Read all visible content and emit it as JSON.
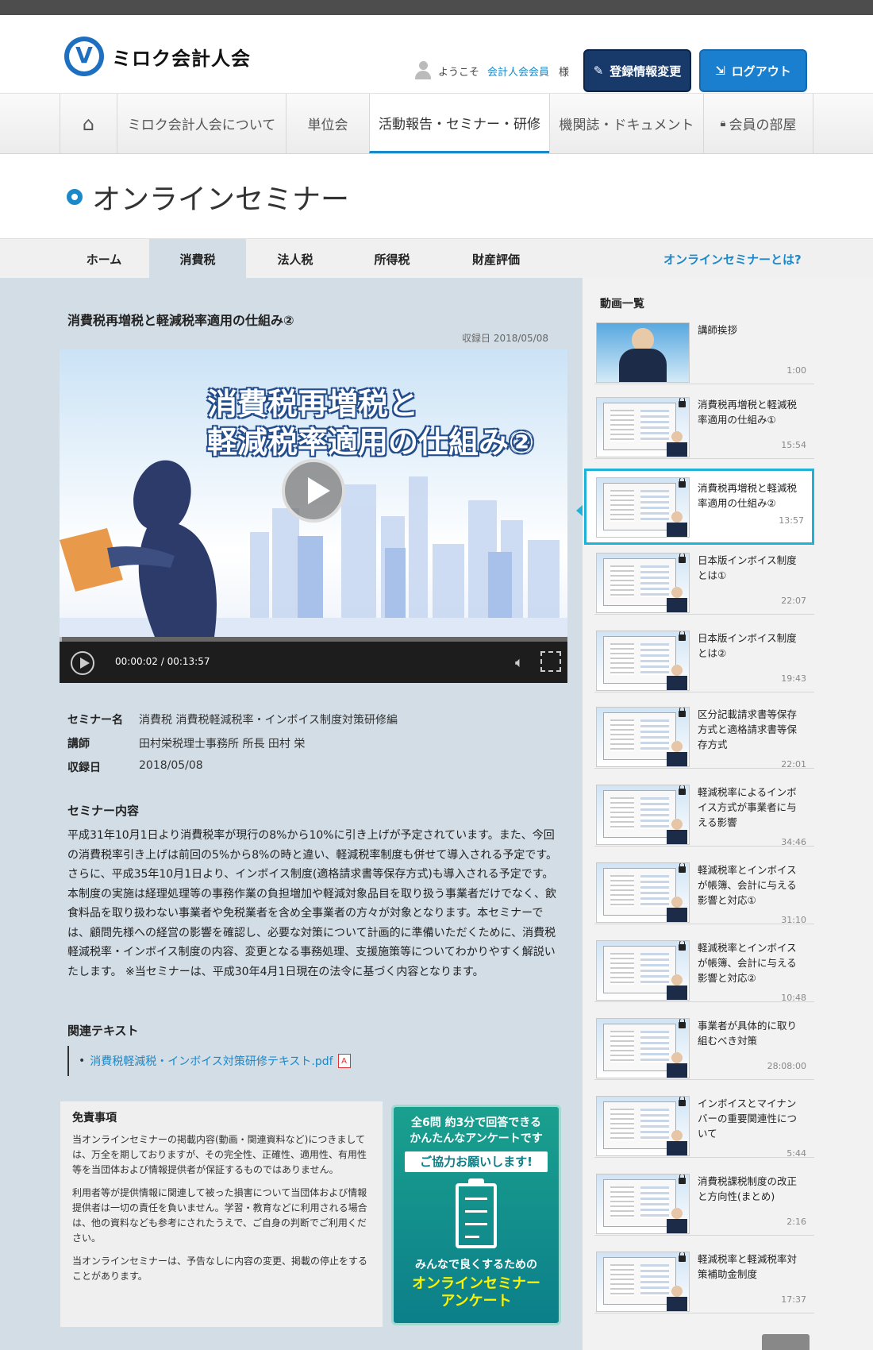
{
  "header": {
    "logo_text": "ミロク会計人会",
    "welcome": "ようこそ",
    "user_name": "会計人会会員",
    "honorific": "様",
    "register_label": "登録情報変更",
    "logout_label": "ログアウト"
  },
  "nav": {
    "items": [
      "ミロク会計人会について",
      "単位会",
      "活動報告・セミナー・研修",
      "機関誌・ドキュメント",
      "会員の部屋"
    ],
    "active": "活動報告・セミナー・研修"
  },
  "section_title": "オンラインセミナー",
  "subnav": {
    "items": [
      "ホーム",
      "消費税",
      "法人税",
      "所得税",
      "財産評価"
    ],
    "active": "消費税",
    "about_link": "オンラインセミナーとは?"
  },
  "video": {
    "title": "消費税再増税と軽減税率適用の仕組み②",
    "recorded_label": "収録日 2018/05/08",
    "slide_line1": "消費税再増税と",
    "slide_line2": "軽減税率適用の仕組み②",
    "time": "00:00:02 / 00:13:57",
    "progress": 0.003
  },
  "info": {
    "seminar_label": "セミナー名",
    "seminar_value": "消費税 消費税軽減税率・インボイス制度対策研修編",
    "lecturer_label": "講師",
    "lecturer_value": "田村栄税理士事務所 所長 田村 栄",
    "date_label": "収録日",
    "date_value": "2018/05/08"
  },
  "content": {
    "heading": "セミナー内容",
    "text": "平成31年10月1日より消費税率が現行の8%から10%に引き上げが予定されています。また、今回の消費税率引き上げは前回の5%から8%の時と違い、軽減税率制度も併せて導入される予定です。さらに、平成35年10月1日より、インボイス制度(適格請求書等保存方式)も導入される予定です。 本制度の実施は経理処理等の事務作業の負担増加や軽減対象品目を取り扱う事業者だけでなく、飲食料品を取り扱わない事業者や免税業者を含め全事業者の方々が対象となります。本セミナーでは、顧問先様への経営の影響を確認し、必要な対策について計画的に準備いただくために、消費税軽減税率・インボイス制度の内容、変更となる事務処理、支援施策等についてわかりやすく解説いたします。 ※当セミナーは、平成30年4月1日現在の法令に基づく内容となります。"
  },
  "related": {
    "heading": "関連テキスト",
    "link": "消費税軽減税・インボイス対策研修テキスト.pdf"
  },
  "disclaimer": {
    "title": "免責事項",
    "p1": "当オンラインセミナーの掲載内容(動画・関連資料など)につきましては、万全を期しておりますが、その完全性、正確性、適用性、有用性等を当団体および情報提供者が保証するものではありません。",
    "p2": "利用者等が提供情報に関連して被った損害について当団体および情報提供者は一切の責任を負いません。学習・教育などに利用される場合は、他の資料なども参考にされたうえで、ご自身の判断でご利用ください。",
    "p3": "当オンラインセミナーは、予告なしに内容の変更、掲載の停止をすることがあります。"
  },
  "survey": {
    "line1a": "全6問 約3分で回答できる",
    "line1b": "かんたんなアンケートです",
    "banner": "ご協力お願いします!",
    "line3": "みんなで良くするための",
    "line4a": "オンラインセミナー",
    "line4b": "アンケート"
  },
  "sidebar": {
    "title": "動画一覧",
    "videos": [
      {
        "title": "講師挨拶",
        "duration": "1:00"
      },
      {
        "title": "消費税再増税と軽減税率適用の仕組み①",
        "duration": "15:54"
      },
      {
        "title": "消費税再増税と軽減税率適用の仕組み②",
        "duration": "13:57"
      },
      {
        "title": "日本版インボイス制度とは①",
        "duration": "22:07"
      },
      {
        "title": "日本版インボイス制度とは②",
        "duration": "19:43"
      },
      {
        "title": "区分記載請求書等保存方式と適格請求書等保存方式",
        "duration": "22:01"
      },
      {
        "title": "軽減税率によるインボイス方式が事業者に与える影響",
        "duration": "34:46"
      },
      {
        "title": "軽減税率とインボイスが帳簿、会計に与える影響と対応①",
        "duration": "31:10"
      },
      {
        "title": "軽減税率とインボイスが帳簿、会計に与える影響と対応②",
        "duration": "10:48"
      },
      {
        "title": "事業者が具体的に取り組むべき対策",
        "duration": "28:08:00"
      },
      {
        "title": "インボイスとマイナンバーの重要関連性について",
        "duration": "5:44"
      },
      {
        "title": "消費税課税制度の改正と方向性(まとめ)",
        "duration": "2:16"
      },
      {
        "title": "軽減税率と軽減税率対策補助金制度",
        "duration": "17:37"
      }
    ]
  }
}
